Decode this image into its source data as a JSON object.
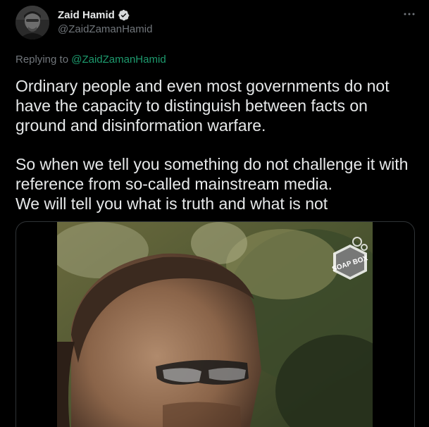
{
  "author": {
    "display_name": "Zaid Hamid",
    "handle": "@ZaidZamanHamid",
    "verified": true
  },
  "reply": {
    "prefix": "Replying to",
    "mention": "@ZaidZamanHamid"
  },
  "tweet": {
    "paragraph_1": "Ordinary people and even most governments do not have the capacity to distinguish between facts on ground and disinformation warfare.",
    "paragraph_2_line_1": "So when we tell you something do not challenge it with reference from so-called mainstream media.",
    "paragraph_2_line_2": "We will tell you what is truth and what is not"
  },
  "media": {
    "watermark_text": "SOAP BOX"
  },
  "icons": {
    "more": "more-horizontal-icon",
    "verified": "verified-badge-icon"
  },
  "colors": {
    "background": "#000000",
    "text": "#e7e9ea",
    "secondary_text": "#71767b",
    "mention": "#1d9b6e",
    "verified_badge": "#d6d9db",
    "border": "#2f3336"
  }
}
